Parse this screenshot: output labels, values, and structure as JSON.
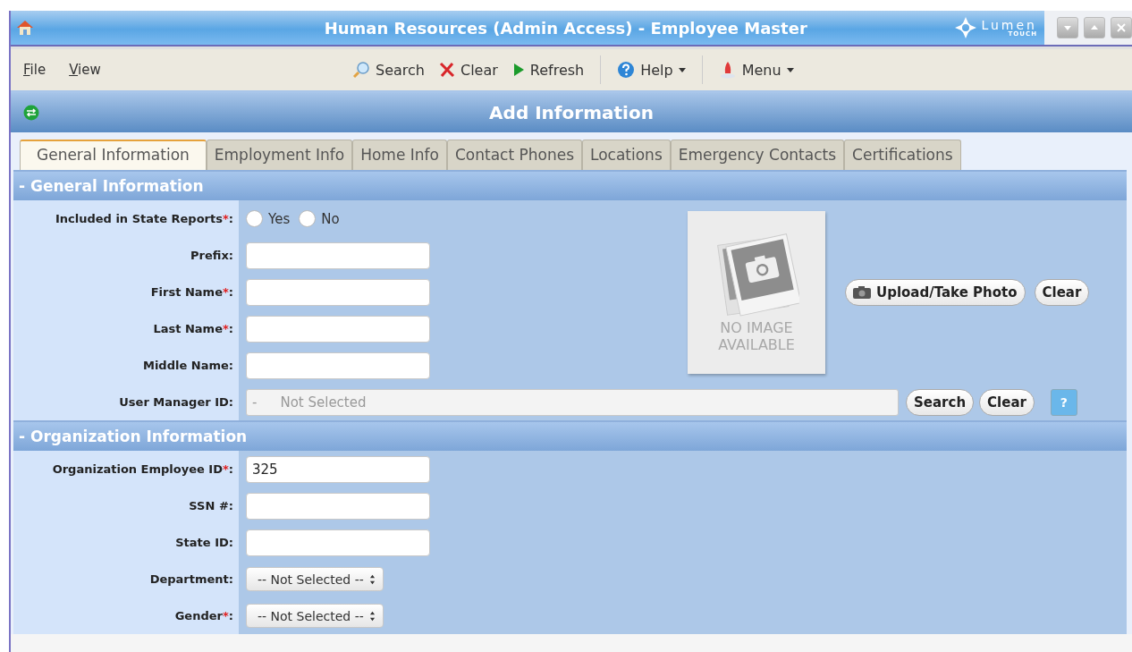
{
  "window": {
    "title": "Human Resources (Admin Access) - Employee Master",
    "brand": "Lumen",
    "brand_sub": "TOUCH"
  },
  "menu": [
    {
      "label": "File"
    },
    {
      "label": "View"
    }
  ],
  "toolbar": [
    {
      "kind": "search",
      "label": "Search",
      "separator_before": false,
      "dropdown": false
    },
    {
      "kind": "clear",
      "label": "Clear",
      "separator_before": false,
      "dropdown": false
    },
    {
      "kind": "refresh",
      "label": "Refresh",
      "separator_before": false,
      "dropdown": false
    },
    {
      "kind": "help",
      "label": "Help",
      "separator_before": true,
      "dropdown": true
    },
    {
      "kind": "menu",
      "label": "Menu",
      "separator_before": true,
      "dropdown": true
    }
  ],
  "header": {
    "title": "Add Information"
  },
  "tabs": [
    {
      "label": "General Information",
      "selected": true
    },
    {
      "label": "Employment Info",
      "selected": false
    },
    {
      "label": "Home Info",
      "selected": false
    },
    {
      "label": "Contact Phones",
      "selected": false
    },
    {
      "label": "Locations",
      "selected": false
    },
    {
      "label": "Emergency Contacts",
      "selected": false
    },
    {
      "label": "Certifications",
      "selected": false
    }
  ],
  "sections": [
    {
      "title": "- General Information",
      "photo": {
        "caption": "NO IMAGE AVAILABLE",
        "upload_button": "Upload/Take Photo",
        "clear_button": "Clear"
      },
      "fields": [
        {
          "kind": "radio",
          "label": "Included in State Reports",
          "mark": "*",
          "colon": ":",
          "options": [
            {
              "label": "Yes",
              "selected": false
            },
            {
              "label": "No",
              "selected": false
            }
          ]
        },
        {
          "kind": "text",
          "label": "Prefix",
          "colon": ":"
        },
        {
          "kind": "text",
          "label": "First Name",
          "mark": "*",
          "colon": ":"
        },
        {
          "kind": "text",
          "label": "Last Name",
          "mark": "*",
          "colon": ":"
        },
        {
          "kind": "text",
          "label": "Middle Name",
          "colon": ":"
        },
        {
          "kind": "lookup",
          "label": "User Manager ID",
          "colon": ":",
          "prefix": "-",
          "value": "Not Selected",
          "search_button": "Search",
          "clear_button": "Clear",
          "help_button": "?"
        }
      ]
    },
    {
      "title": "- Organization Information",
      "fields": [
        {
          "kind": "text",
          "label": "Organization Employee ID",
          "mark": "*",
          "colon": ":",
          "value": "325"
        },
        {
          "kind": "text",
          "label": "SSN #",
          "colon": ":"
        },
        {
          "kind": "text",
          "label": "State ID",
          "colon": ":"
        },
        {
          "kind": "select",
          "label": "Department",
          "colon": ":",
          "value": "-- Not Selected --"
        },
        {
          "kind": "select",
          "label": "Gender",
          "mark": "*",
          "colon": ":",
          "value": "-- Not Selected --"
        }
      ]
    }
  ]
}
